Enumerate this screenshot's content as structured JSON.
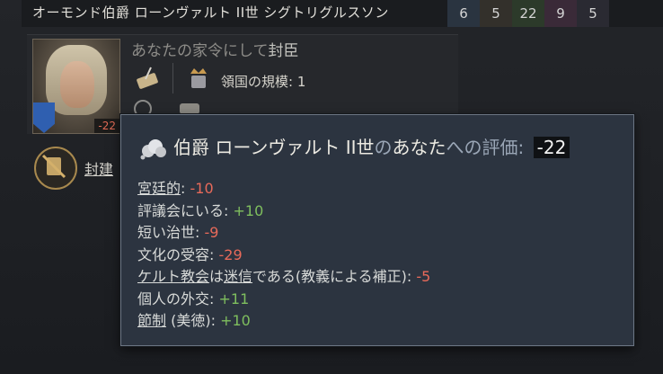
{
  "header": {
    "title": "オーモンド伯爵 ローンヴァルト II世 シグトリグルスソン",
    "stats": [
      {
        "value": "6",
        "color": "#2a3440"
      },
      {
        "value": "5",
        "color": "#33302b"
      },
      {
        "value": "22",
        "color": "#2c3a2a"
      },
      {
        "value": "9",
        "color": "#3a2a38"
      },
      {
        "value": "5",
        "color": "#2a2a32"
      }
    ]
  },
  "character": {
    "relation_prefix": "あなたの家令にして",
    "relation_link": "封臣",
    "opinion_badge": "-22",
    "domain_label": "領国の規模: 1",
    "fief_link": "封建"
  },
  "tooltip": {
    "name": "伯爵 ローンヴァルト II世",
    "name_suffix": "の",
    "you_label": "あなた",
    "opinion_label": "への評価: ",
    "opinion_value": "-22",
    "rows": [
      {
        "label": "宮廷的",
        "sep": ": ",
        "value": "-10"
      },
      {
        "label": "評議会にいる",
        "sep": ": ",
        "value": "+10"
      },
      {
        "label": "短い治世",
        "sep": ": ",
        "value": "-9"
      },
      {
        "label": "文化の受容",
        "sep": ": ",
        "value": "-29"
      },
      {
        "label_a": "ケルト教会",
        "label_mid": "は",
        "label_b": "迷信",
        "label_c": "である(教義による補正)",
        "sep": ": ",
        "value": "-5"
      },
      {
        "label": "個人の外交",
        "sep": ": ",
        "value": "+11"
      },
      {
        "label": "節制",
        "label_extra": " (美徳)",
        "sep": ": ",
        "value": "+10"
      }
    ]
  }
}
